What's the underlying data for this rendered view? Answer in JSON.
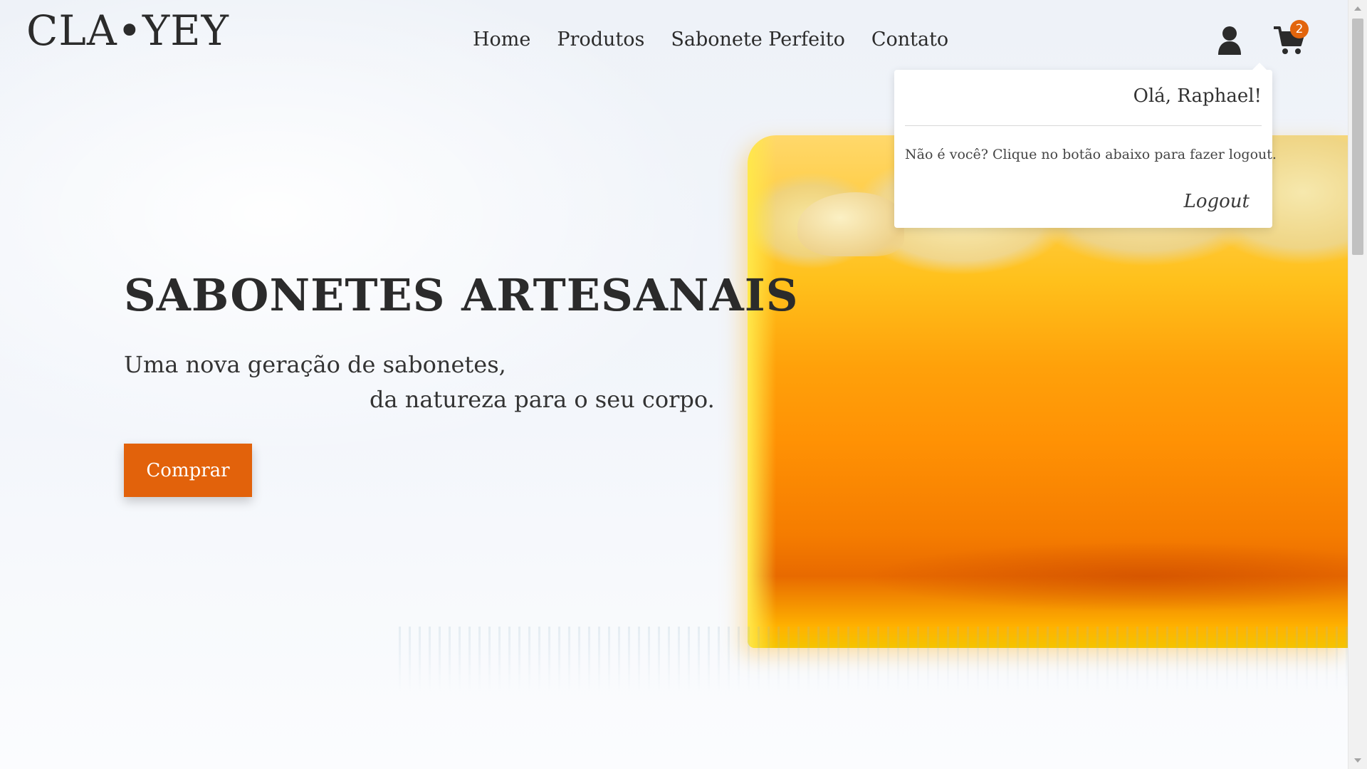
{
  "brand": {
    "logo_text": "CLA•YEY"
  },
  "nav": {
    "items": [
      {
        "label": "Home"
      },
      {
        "label": "Produtos"
      },
      {
        "label": "Sabonete Perfeito"
      },
      {
        "label": "Contato"
      }
    ]
  },
  "header_icons": {
    "user_icon": "user-icon",
    "cart_icon": "shopping-cart-icon",
    "cart_count": "2"
  },
  "user_menu": {
    "greeting": "Olá, Raphael!",
    "message": "Não é você? Clique no botão abaixo para fazer logout.",
    "logout_label": "Logout"
  },
  "hero": {
    "title": "SABONETES ARTESANAIS",
    "subtitle_line1": "Uma nova geração de sabonetes,",
    "subtitle_line2": "da natureza para o seu corpo.",
    "cta_label": "Comprar"
  },
  "colors": {
    "accent": "#e2620b",
    "badge": "#e2650d",
    "text": "#2b2b2b"
  }
}
